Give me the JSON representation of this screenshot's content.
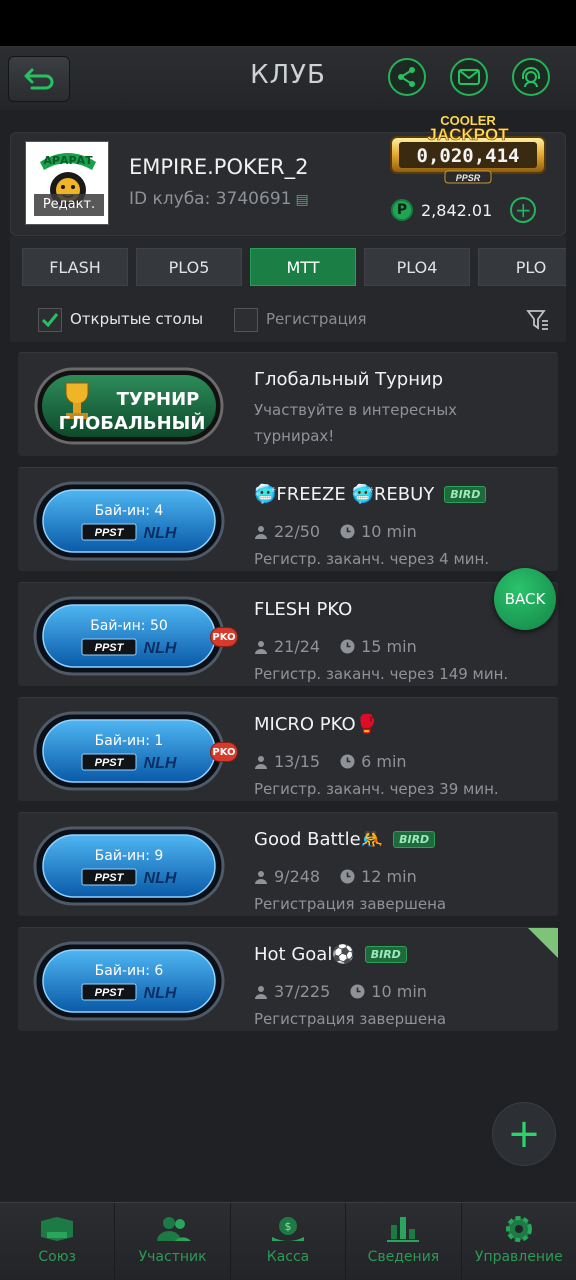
{
  "header": {
    "title": "КЛУБ"
  },
  "club": {
    "logo_text": "АРАРАТ",
    "edit_label": "Редакт.",
    "name": "EMPIRE.POKER_2",
    "id_text": "ID клуба: 3740691",
    "jackpot": {
      "line1": "COOLER",
      "line2": "JACKPOT",
      "value": "0,020,414",
      "brand": "PPSR"
    },
    "balance": {
      "coin": "P",
      "value": "2,842.01"
    }
  },
  "tabs": [
    "FLASH",
    "PLO5",
    "MTT",
    "PLO4",
    "PLO"
  ],
  "active_tab": "MTT",
  "filters": {
    "open_tables": "Открытые столы",
    "registration": "Регистрация"
  },
  "global": {
    "badge_line1": "ТУРНИР",
    "badge_line2": "ГЛОБАЛЬНЫЙ",
    "title": "Глобальный Турнир",
    "desc1": "Участвуйте в интересных",
    "desc2": "турнирах!"
  },
  "tournaments": [
    {
      "buyin": "Бай-ин: 4",
      "brand": "PPST",
      "game": "NLH",
      "title": "🥶FREEZE 🥶REBUY",
      "bird": "BIRD",
      "players": "22/50",
      "time": "10 min",
      "status": "Регистр. заканч. через 4 мин."
    },
    {
      "buyin": "Бай-ин: 50",
      "brand": "PPST",
      "game": "NLH",
      "pko": "PKO",
      "title": "FLESH PKO",
      "players": "21/24",
      "time": "15 min",
      "status": "Регистр. заканч. через 149 мин."
    },
    {
      "buyin": "Бай-ин: 1",
      "brand": "PPST",
      "game": "NLH",
      "pko": "PKO",
      "title": "MICRO PKO🥊",
      "players": "13/15",
      "time": "6 min",
      "status": "Регистр. заканч. через 39 мин."
    },
    {
      "buyin": "Бай-ин: 9",
      "brand": "PPST",
      "game": "NLH",
      "title": "Good Battle🤼",
      "bird": "BIRD",
      "players": "9/248",
      "time": "12 min",
      "status": "Регистрация завершена"
    },
    {
      "buyin": "Бай-ин: 6",
      "brand": "PPST",
      "game": "NLH",
      "title": "Hot Goal⚽",
      "bird": "BIRD",
      "players": "37/225",
      "time": "10 min",
      "status": "Регистрация завершена"
    }
  ],
  "back_button": "BACK",
  "bottom_nav": [
    {
      "label": "Союз",
      "icon": "union-icon"
    },
    {
      "label": "Участник",
      "icon": "members-icon"
    },
    {
      "label": "Касса",
      "icon": "cashier-icon"
    },
    {
      "label": "Сведения",
      "icon": "stats-icon"
    },
    {
      "label": "Управление",
      "icon": "settings-icon"
    }
  ],
  "colors": {
    "accent": "#25b35a",
    "background": "#1f2124",
    "card": "#2a2c30",
    "active_tab": "#1b7f45"
  }
}
